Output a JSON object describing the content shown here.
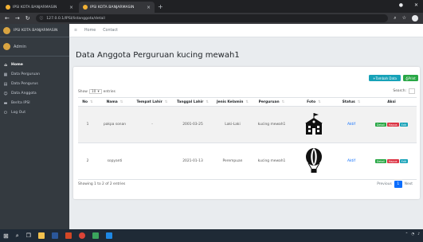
{
  "browser": {
    "tabs": [
      {
        "label": "IPSI KOTA BANJARMASIN",
        "active": false
      },
      {
        "label": "IPSI KOTA BANJARMASIN",
        "active": true
      }
    ],
    "url": "127.0.0.1/IPSI/listanggota/detail"
  },
  "sidebar": {
    "brand": "IPSI KOTA BANJARMASIN",
    "user": "Admin",
    "items": [
      {
        "icon": "home-icon",
        "label": "Home"
      },
      {
        "icon": "table-icon",
        "label": "Data Perguruan"
      },
      {
        "icon": "list-icon",
        "label": "Data Pengurus"
      },
      {
        "icon": "users-icon",
        "label": "Data Anggota"
      },
      {
        "icon": "card-icon",
        "label": "Berita IPSI"
      },
      {
        "icon": "power-icon",
        "label": "Log Out"
      }
    ]
  },
  "navbar": {
    "home": "Home",
    "contact": "Contact"
  },
  "main": {
    "title": "Data Anggota Perguruan kucing mewah1",
    "add_button": "Tambah Data",
    "print_button": "Print",
    "show_prefix": "Show",
    "show_value": "10",
    "show_suffix": "entries",
    "search_label": "Search:",
    "columns": [
      "No",
      "Nama",
      "Tempat Lahir",
      "Tanggal Lahir",
      "Jenis Kelamin",
      "Perguruan",
      "Foto",
      "Status",
      "Aksi"
    ],
    "rows": [
      {
        "no": "1",
        "nama": "pakpa sonan",
        "tempat": "-",
        "tanggal": "2001-03-25",
        "jk": "Laki-Laki",
        "perguruan": "kucing mewah1",
        "foto": "school",
        "status": "Aktif"
      },
      {
        "no": "2",
        "nama": "sopyanti",
        "tempat": "",
        "tanggal": "2021-01-13",
        "jk": "Perempuan",
        "perguruan": "kucing mewah1",
        "foto": "balloon",
        "status": "Aktif"
      }
    ],
    "actions": [
      "Detail",
      "Hapus",
      "Edit"
    ],
    "info": "Showing 1 to 2 of 2 entries",
    "pager": {
      "prev": "Previous",
      "current": "1",
      "next": "Next"
    }
  }
}
